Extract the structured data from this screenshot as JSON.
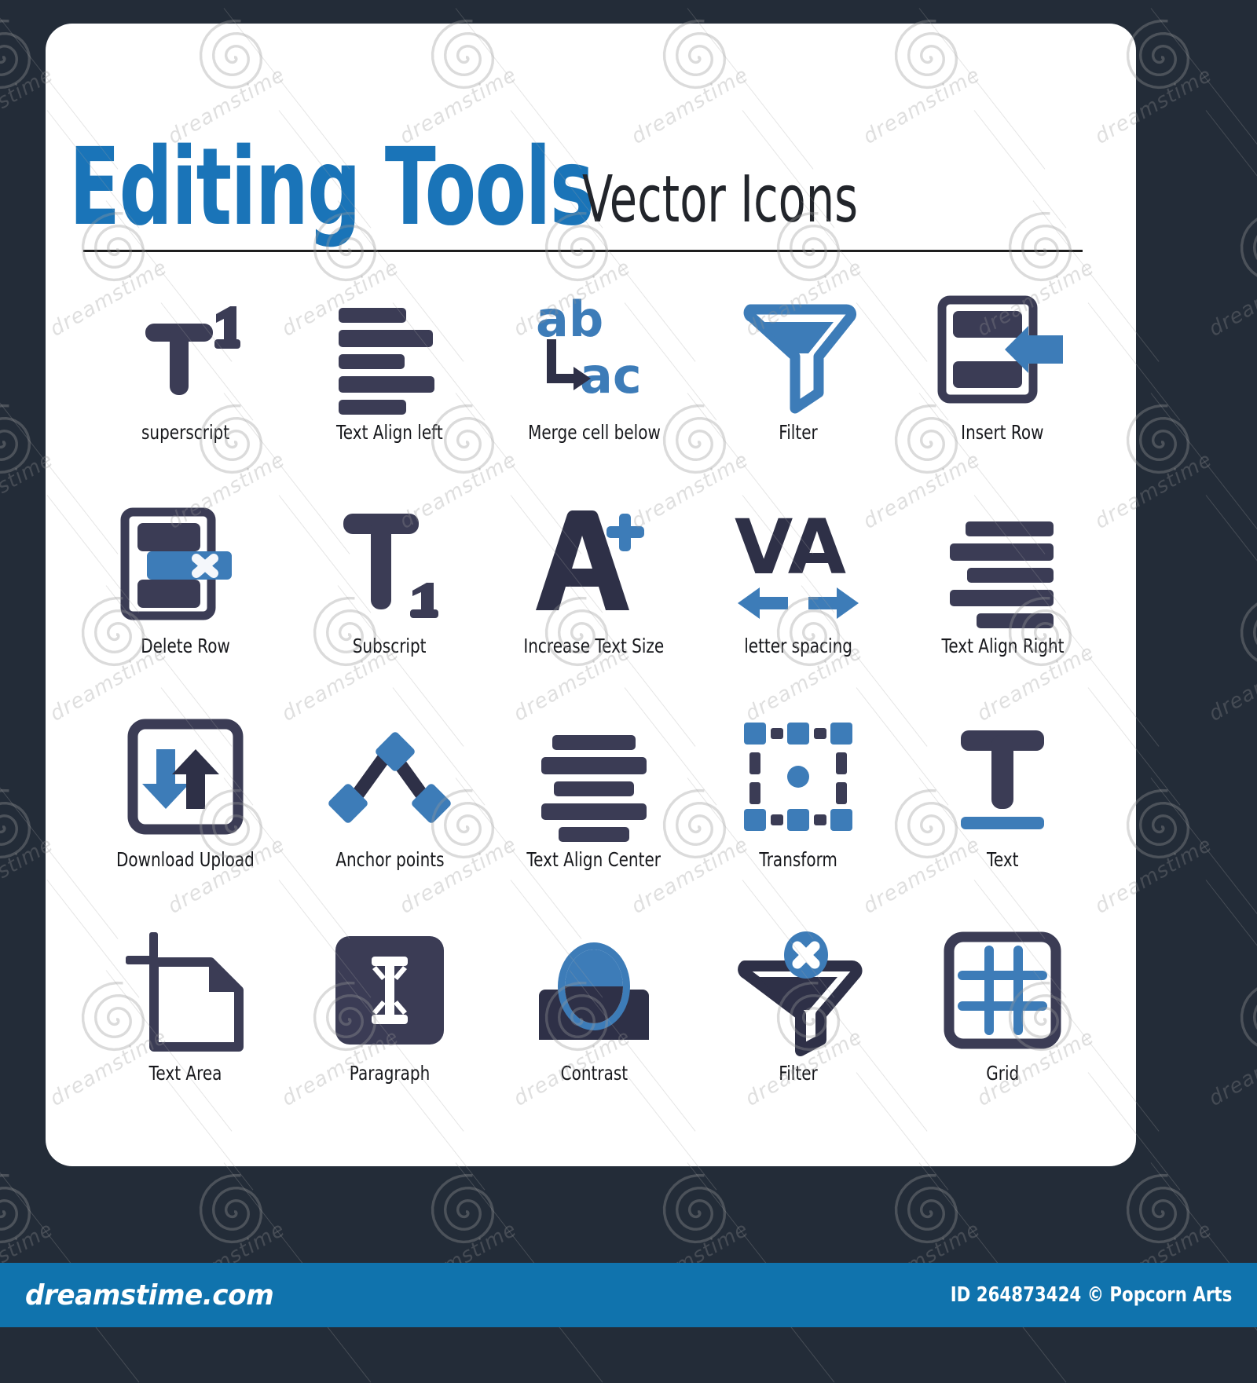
{
  "header": {
    "title_main": "Editing Tools",
    "title_sub": "Vector Icons"
  },
  "palette": {
    "dark": "#3b3c55",
    "blue": "#3d7cb8",
    "page_bg": "#232c38",
    "card_bg": "#ffffff",
    "footer_bg": "#1073ad",
    "title_blue": "#1a74b8"
  },
  "icons": [
    {
      "label": "superscript",
      "icon_name": "superscript-icon"
    },
    {
      "label": "Text Align left",
      "icon_name": "text-align-left-icon"
    },
    {
      "label": "Merge cell below",
      "icon_name": "merge-cell-below-icon"
    },
    {
      "label": "Filter",
      "icon_name": "filter-funnel-icon"
    },
    {
      "label": "Insert Row",
      "icon_name": "insert-row-icon"
    },
    {
      "label": "Delete Row",
      "icon_name": "delete-row-icon"
    },
    {
      "label": "Subscript",
      "icon_name": "subscript-icon"
    },
    {
      "label": "Increase Text Size",
      "icon_name": "increase-text-size-icon"
    },
    {
      "label": "letter spacing",
      "icon_name": "letter-spacing-icon"
    },
    {
      "label": "Text Align Right",
      "icon_name": "text-align-right-icon"
    },
    {
      "label": "Download Upload",
      "icon_name": "download-upload-icon"
    },
    {
      "label": "Anchor points",
      "icon_name": "anchor-points-icon"
    },
    {
      "label": "Text Align Center",
      "icon_name": "text-align-center-icon"
    },
    {
      "label": "Transform",
      "icon_name": "transform-icon"
    },
    {
      "label": "Text",
      "icon_name": "text-icon"
    },
    {
      "label": "Text Area",
      "icon_name": "text-area-icon"
    },
    {
      "label": "Paragraph",
      "icon_name": "paragraph-icon"
    },
    {
      "label": "Contrast",
      "icon_name": "contrast-icon"
    },
    {
      "label": "Filter",
      "icon_name": "filter-remove-icon"
    },
    {
      "label": "Grid",
      "icon_name": "grid-icon"
    }
  ],
  "footer": {
    "brand": "dreamstime.com",
    "credit": "ID 264873424 © Popcorn Arts"
  },
  "watermark": {
    "text": "dreamstime"
  }
}
